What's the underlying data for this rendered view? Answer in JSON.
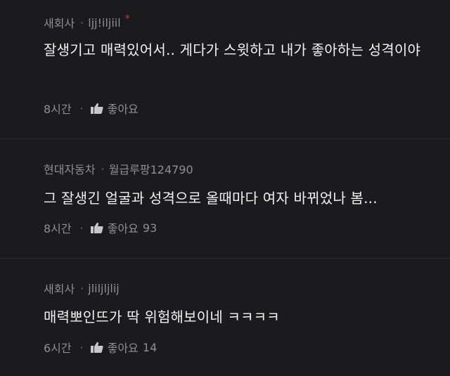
{
  "comments": [
    {
      "company": "새회사",
      "nickname": "ljj!iljiil",
      "star": "*",
      "text": "잘생기고 매력있어서.. 게다가 스윗하고 내가 좋아하는 성격이야",
      "time": "8시간",
      "like_label": "좋아요",
      "likes": ""
    },
    {
      "company": "현대자동차",
      "nickname": "월급루팡124790",
      "star": "",
      "text": "그 잘생긴 얼굴과 성격으로 올때마다 여자 바뀌었나 봄...",
      "time": "8시간",
      "like_label": "좋아요",
      "likes": "93"
    },
    {
      "company": "새회사",
      "nickname": "jliljljlij",
      "star": "",
      "text": "매력뽀인뜨가 딱 위험해보이네 ㅋㅋㅋㅋ",
      "time": "6시간",
      "like_label": "좋아요",
      "likes": "14"
    }
  ],
  "separator": "·",
  "colors": {
    "background": "#1b1b1d",
    "text": "#f2f2f4",
    "muted": "#8e8e93",
    "star": "#e0333a"
  }
}
